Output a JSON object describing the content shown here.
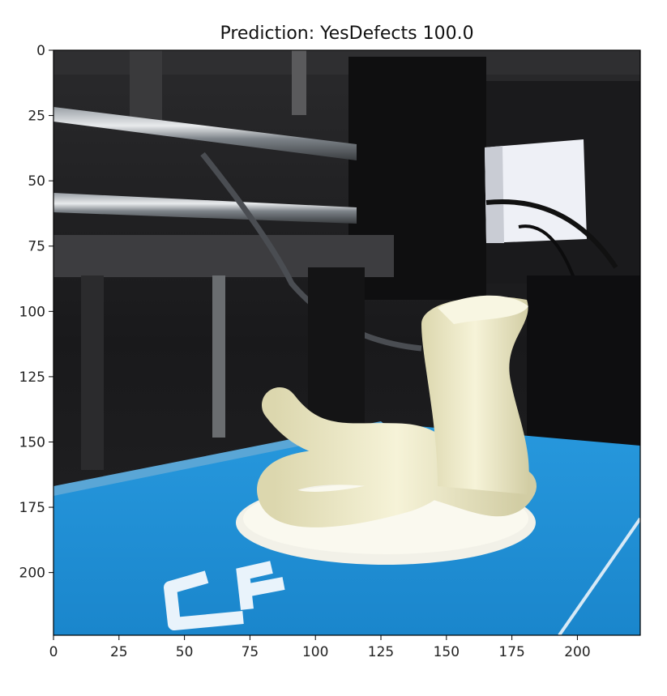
{
  "chart_data": {
    "type": "image",
    "title": "Prediction: YesDefects 100.0",
    "xlim": [
      0,
      224
    ],
    "ylim": [
      224,
      0
    ],
    "xticks": [
      0,
      25,
      50,
      75,
      100,
      125,
      150,
      175,
      200
    ],
    "yticks": [
      0,
      25,
      50,
      75,
      100,
      125,
      150,
      175,
      200
    ],
    "xtick_labels": [
      "0",
      "25",
      "50",
      "75",
      "100",
      "125",
      "150",
      "175",
      "200"
    ],
    "ytick_labels": [
      "0",
      "25",
      "50",
      "75",
      "100",
      "125",
      "150",
      "175",
      "200"
    ],
    "grid": false,
    "image_subject": "3D printer with a white cobra-shaped print on a blue build plate"
  },
  "colors": {
    "build_plate": "#1f8fd6",
    "print_white": "#efeccd",
    "frame_dark": "#1c1c1e",
    "axis": "#000000"
  }
}
